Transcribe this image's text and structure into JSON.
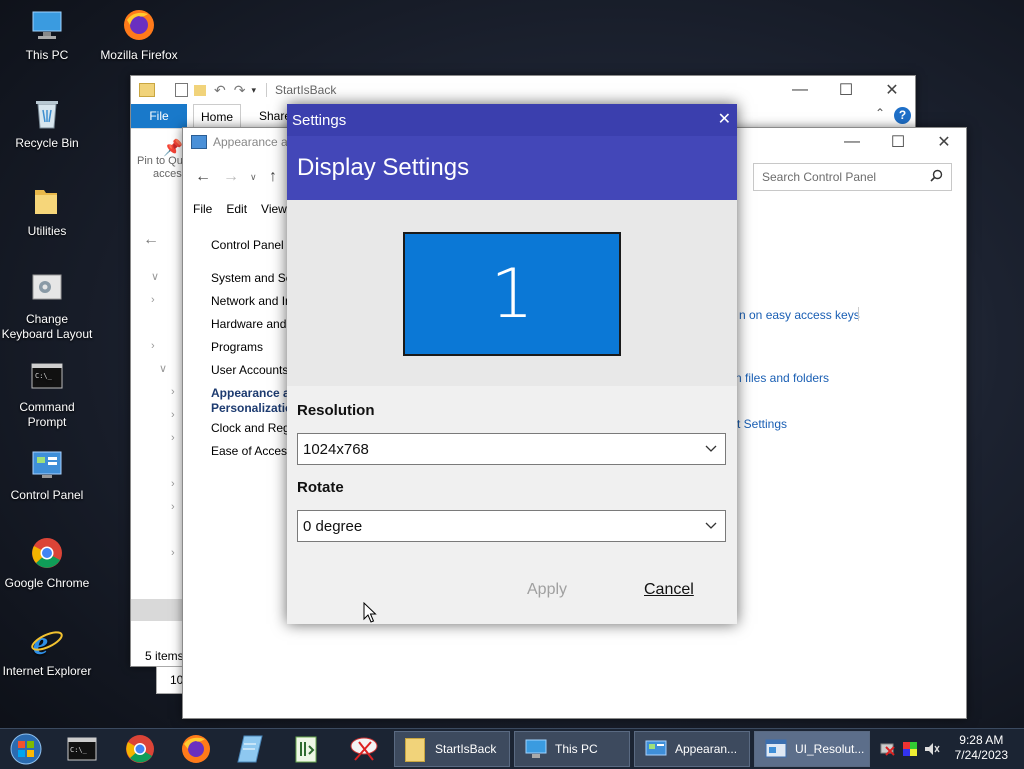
{
  "desktop_icons": [
    {
      "label": "This PC",
      "icon": "this-pc-icon"
    },
    {
      "label": "Mozilla Firefox",
      "icon": "firefox-icon"
    },
    {
      "label": "Recycle Bin",
      "icon": "recycle-bin-icon"
    },
    {
      "label": "Utilities",
      "icon": "folder-icon"
    },
    {
      "label": "Change Keyboard Layout",
      "icon": "keyboard-icon"
    },
    {
      "label": "Command Prompt",
      "icon": "cmd-icon"
    },
    {
      "label": "Control Panel",
      "icon": "control-panel-icon"
    },
    {
      "label": "Google Chrome",
      "icon": "chrome-icon"
    },
    {
      "label": "Internet Explorer",
      "icon": "ie-icon"
    }
  ],
  "explorer": {
    "title": "StartIsBack",
    "tab_file": "File",
    "tab_home": "Home",
    "tab_share": "Share",
    "pin_label": "Pin to Qu",
    "access_label": "access",
    "status": "5 items",
    "size_text": "10"
  },
  "control_panel": {
    "title": "Appearance ar",
    "search_placeholder": "Search Control Panel",
    "menu": [
      "File",
      "Edit",
      "View"
    ],
    "nav": [
      "Control Panel",
      "System and Se",
      "Network and In",
      "Hardware and",
      "Programs",
      "User Accounts",
      "Appearance a",
      "Personalizatio",
      "Clock and Reg",
      "Ease of Access"
    ],
    "links": [
      "n on easy access keys",
      "n files and folders",
      "t Settings"
    ]
  },
  "dialog": {
    "title": "Settings",
    "header": "Display Settings",
    "monitor_number": "1",
    "resolution_label": "Resolution",
    "resolution_value": "1024x768",
    "rotate_label": "Rotate",
    "rotate_value": "0 degree",
    "apply": "Apply",
    "cancel": "Cancel"
  },
  "taskbar": {
    "apps": [
      {
        "label": "StartIsBack",
        "icon": "folder-icon"
      },
      {
        "label": "This PC",
        "icon": "this-pc-icon"
      },
      {
        "label": "Appearan...",
        "icon": "control-panel-icon"
      },
      {
        "label": "UI_Resolut...",
        "icon": "app-window-icon"
      }
    ],
    "time": "9:28 AM",
    "date": "7/24/2023"
  }
}
